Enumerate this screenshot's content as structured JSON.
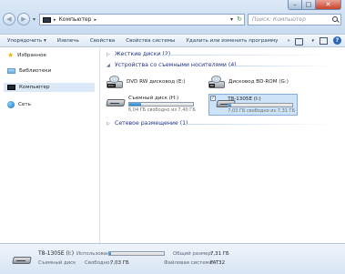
{
  "window": {
    "minimize": "–",
    "maximize": "□",
    "close": "✕"
  },
  "nav": {
    "back": "◀",
    "forward": "▶",
    "dropdown": "▾"
  },
  "address": {
    "separator": "▸",
    "location": "Компьютер",
    "dropdown": "▾",
    "refresh": "↻"
  },
  "search": {
    "placeholder": "Поиск: Компьютер"
  },
  "toolbar": {
    "organize": "Упорядочить ▾",
    "eject": "Извлечь",
    "properties": "Свойства",
    "system_properties": "Свойства системы",
    "uninstall": "Удалить или изменить программу",
    "more": "»",
    "view_caret": "▾",
    "help": "?"
  },
  "sidebar": {
    "items": [
      {
        "label": "Избранное"
      },
      {
        "label": "Библиотеки"
      },
      {
        "label": "Компьютер"
      },
      {
        "label": "Сеть"
      }
    ]
  },
  "groups": {
    "hard_disks": {
      "arrow": "▷",
      "label": "Жесткие диски (2)"
    },
    "removable": {
      "arrow": "◢",
      "label": "Устройства со съемными носителями (4)"
    },
    "network": {
      "arrow": "▷",
      "label": "Сетевое размещение (1)"
    }
  },
  "devices": [
    {
      "name": "DVD RW дисковод (E:)",
      "tag": "DVD"
    },
    {
      "name": "Дисковод BD-ROM (G:)",
      "tag": "BD"
    },
    {
      "name": "Съемный диск (H:)",
      "free_text": "6,04 ГБ свободно из 7,40 ГБ",
      "used_fraction": 0.18
    },
    {
      "name": "T8-1305E (I:)",
      "free_text": "7,03 ГБ свободно из 7,31 ГБ",
      "used_fraction": 0.04,
      "check": "✓"
    }
  ],
  "details": {
    "name": "T8-1305E (I:)",
    "type": "Съемный диск",
    "used_label": "Использовано:",
    "used_fraction": 0.04,
    "free_label": "Свободно:",
    "free_value": "7,03 ГБ",
    "total_label": "Общий размер:",
    "total_value": "7,31 ГБ",
    "fs_label": "Файловая система:",
    "fs_value": "FAT32"
  }
}
